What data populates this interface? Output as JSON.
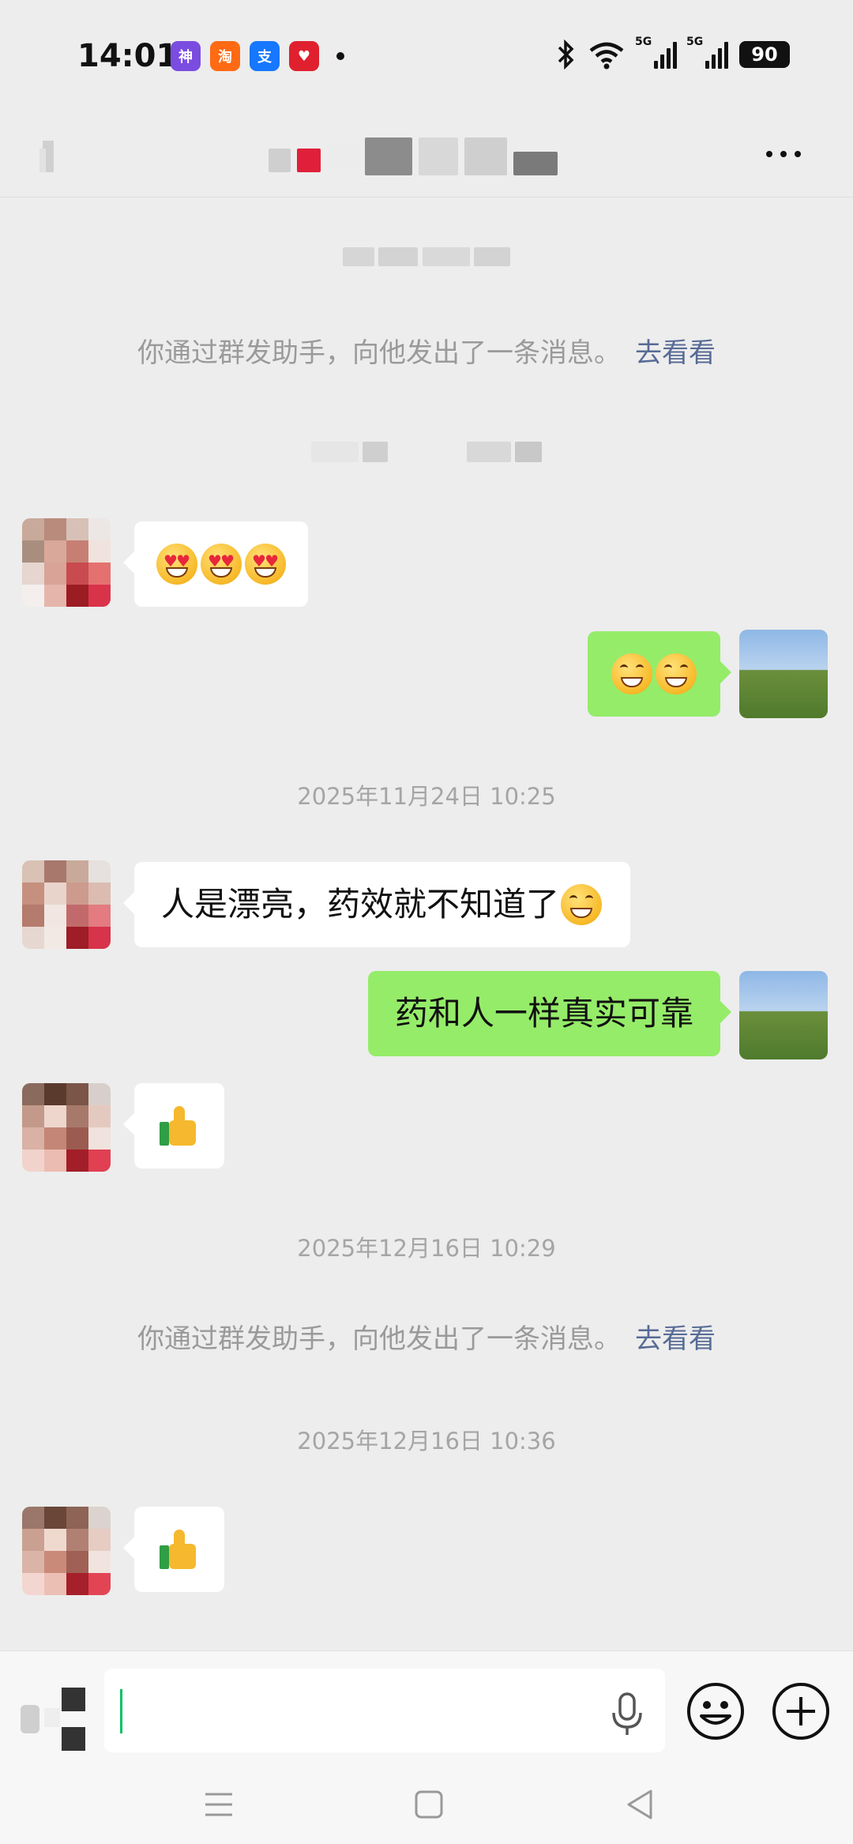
{
  "status_bar": {
    "time": "14:01",
    "app_icons": [
      {
        "name": "shenzi-app-icon",
        "label": "神",
        "color": "#7b4ce0"
      },
      {
        "name": "taobao-app-icon",
        "label": "淘",
        "color": "#ff6a13"
      },
      {
        "name": "alipay-app-icon",
        "label": "支",
        "color": "#1677ff"
      },
      {
        "name": "heart-app-icon",
        "label": "♥",
        "color": "#e0202e"
      }
    ],
    "battery": "90"
  },
  "chat": {
    "timestamp_1": "2025年11月24日 10:25",
    "timestamp_2": "2025年12月16日 10:29",
    "timestamp_3": "2025年12月16日 10:36",
    "system_msg_text": "你通过群发助手，向他发出了一条消息。",
    "system_msg_link": "去看看",
    "message_3_text": "人是漂亮，药效就不知道了",
    "message_4_text": "药和人一样真实可靠"
  },
  "colors": {
    "background": "#ededed",
    "bubble_self": "#95ec69",
    "bubble_other": "#ffffff",
    "link": "#576b95",
    "caret": "#07c160"
  }
}
